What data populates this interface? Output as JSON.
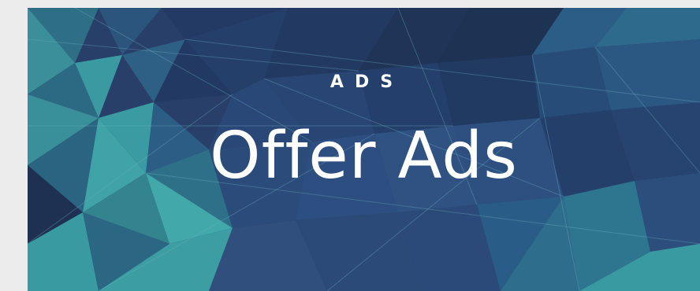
{
  "banner": {
    "eyebrow": "ADS",
    "title": "Offer Ads",
    "background_colors": [
      "#27406a",
      "#2e5a86",
      "#3a9aa3",
      "#1f3152"
    ]
  }
}
